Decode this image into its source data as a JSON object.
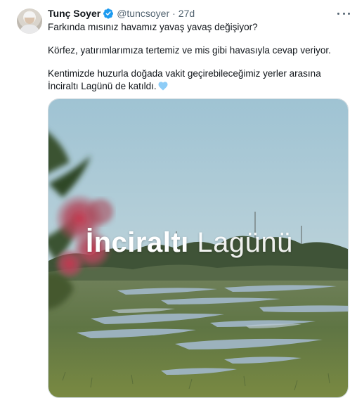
{
  "tweet": {
    "author_name": "Tunç Soyer",
    "author_handle": "@tuncsoyer",
    "separator": "·",
    "time": "27d",
    "paragraphs": [
      "Farkında mısınız havamız yavaş yavaş değişiyor?",
      "Körfez, yatırımlarımıza tertemiz ve mis gibi havasıyla cevap veriyor.",
      "Kentimizde huzurla doğada vakit geçirebileceğimiz yerler arasına İnciraltı Lagünü de katıldı."
    ],
    "emoji_icon": "blue-heart-icon",
    "verified_icon": "verified-badge-icon",
    "more_icon": "more-dots-icon"
  },
  "media": {
    "title_bold": "İnciraltı",
    "title_light": "Lagünü"
  },
  "colors": {
    "primary_text": "#0f1419",
    "secondary_text": "#536471",
    "verified": "#1d9bf0",
    "heart": "#8ecdf7",
    "border": "#cfd9de"
  }
}
